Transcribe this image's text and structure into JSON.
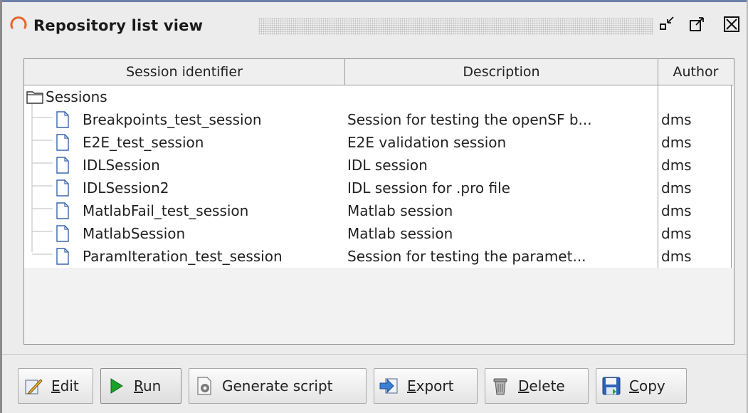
{
  "window": {
    "title": "Repository list view",
    "controls": {
      "minimize_icon": "minimize-icon",
      "maximize_icon": "maximize-icon",
      "close_icon": "close-icon"
    }
  },
  "table": {
    "columns": [
      "Session identifier",
      "Description",
      "Author"
    ],
    "root": {
      "label": "Sessions",
      "icon": "folder-icon"
    },
    "rows": [
      {
        "id": "Breakpoints_test_session",
        "description": "Session for testing the openSF b...",
        "author": "dms"
      },
      {
        "id": "E2E_test_session",
        "description": "E2E validation session",
        "author": "dms"
      },
      {
        "id": "IDLSession",
        "description": "IDL session",
        "author": "dms"
      },
      {
        "id": "IDLSession2",
        "description": "IDL session for .pro file",
        "author": "dms"
      },
      {
        "id": "MatlabFail_test_session",
        "description": "Matlab session",
        "author": "dms"
      },
      {
        "id": "MatlabSession",
        "description": "Matlab session",
        "author": "dms"
      },
      {
        "id": "ParamIteration_test_session",
        "description": "Session for testing the paramet...",
        "author": "dms"
      }
    ]
  },
  "toolbar": {
    "edit": {
      "mnemonic": "E",
      "rest": "dit",
      "icon": "edit-icon"
    },
    "run": {
      "mnemonic": "R",
      "rest": "un",
      "icon": "play-icon"
    },
    "generate_script": {
      "label": "Generate script",
      "icon": "script-icon"
    },
    "export": {
      "mnemonic": "E",
      "rest": "xport",
      "icon": "export-icon"
    },
    "delete": {
      "mnemonic": "D",
      "rest": "elete",
      "icon": "trash-icon"
    },
    "copy": {
      "mnemonic": "C",
      "rest": "opy",
      "icon": "save-icon"
    }
  }
}
